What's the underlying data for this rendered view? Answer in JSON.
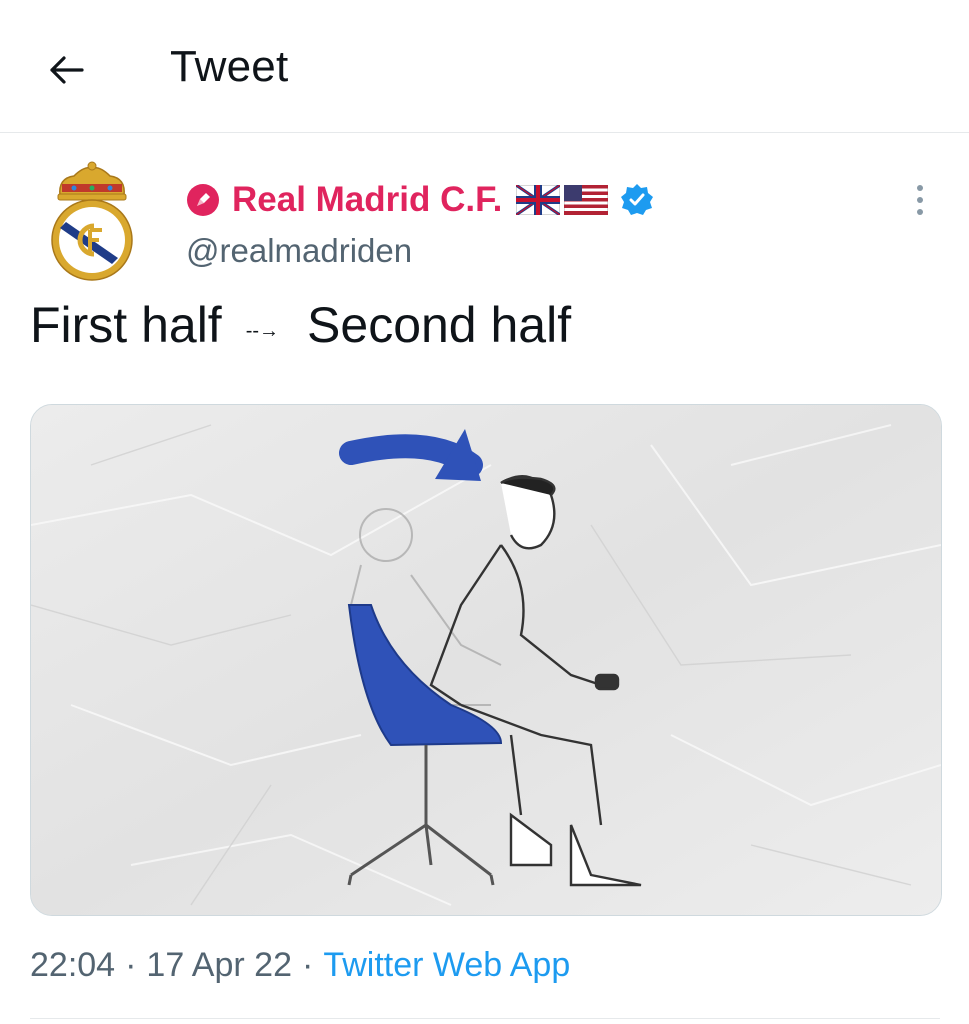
{
  "header": {
    "title": "Tweet",
    "back_icon": "back-arrow-icon"
  },
  "tweet": {
    "author": {
      "name": "Real Madrid C.F.",
      "handle": "@realmadriden",
      "verified": true,
      "name_color": "#e0245e",
      "avatar_icon": "real-madrid-crest-icon",
      "flags": [
        "uk-flag-icon",
        "us-flag-icon"
      ]
    },
    "text": {
      "part1": "First half",
      "arrow": "--→",
      "part2": "Second half"
    },
    "media": {
      "icon": "chair-illustration-icon"
    },
    "time": "22:04",
    "date": "17 Apr 22",
    "separator": "·",
    "source": "Twitter Web App"
  },
  "colors": {
    "accent": "#1d9bf0",
    "secondary_text": "#536471",
    "divider": "#e6e9eb"
  }
}
